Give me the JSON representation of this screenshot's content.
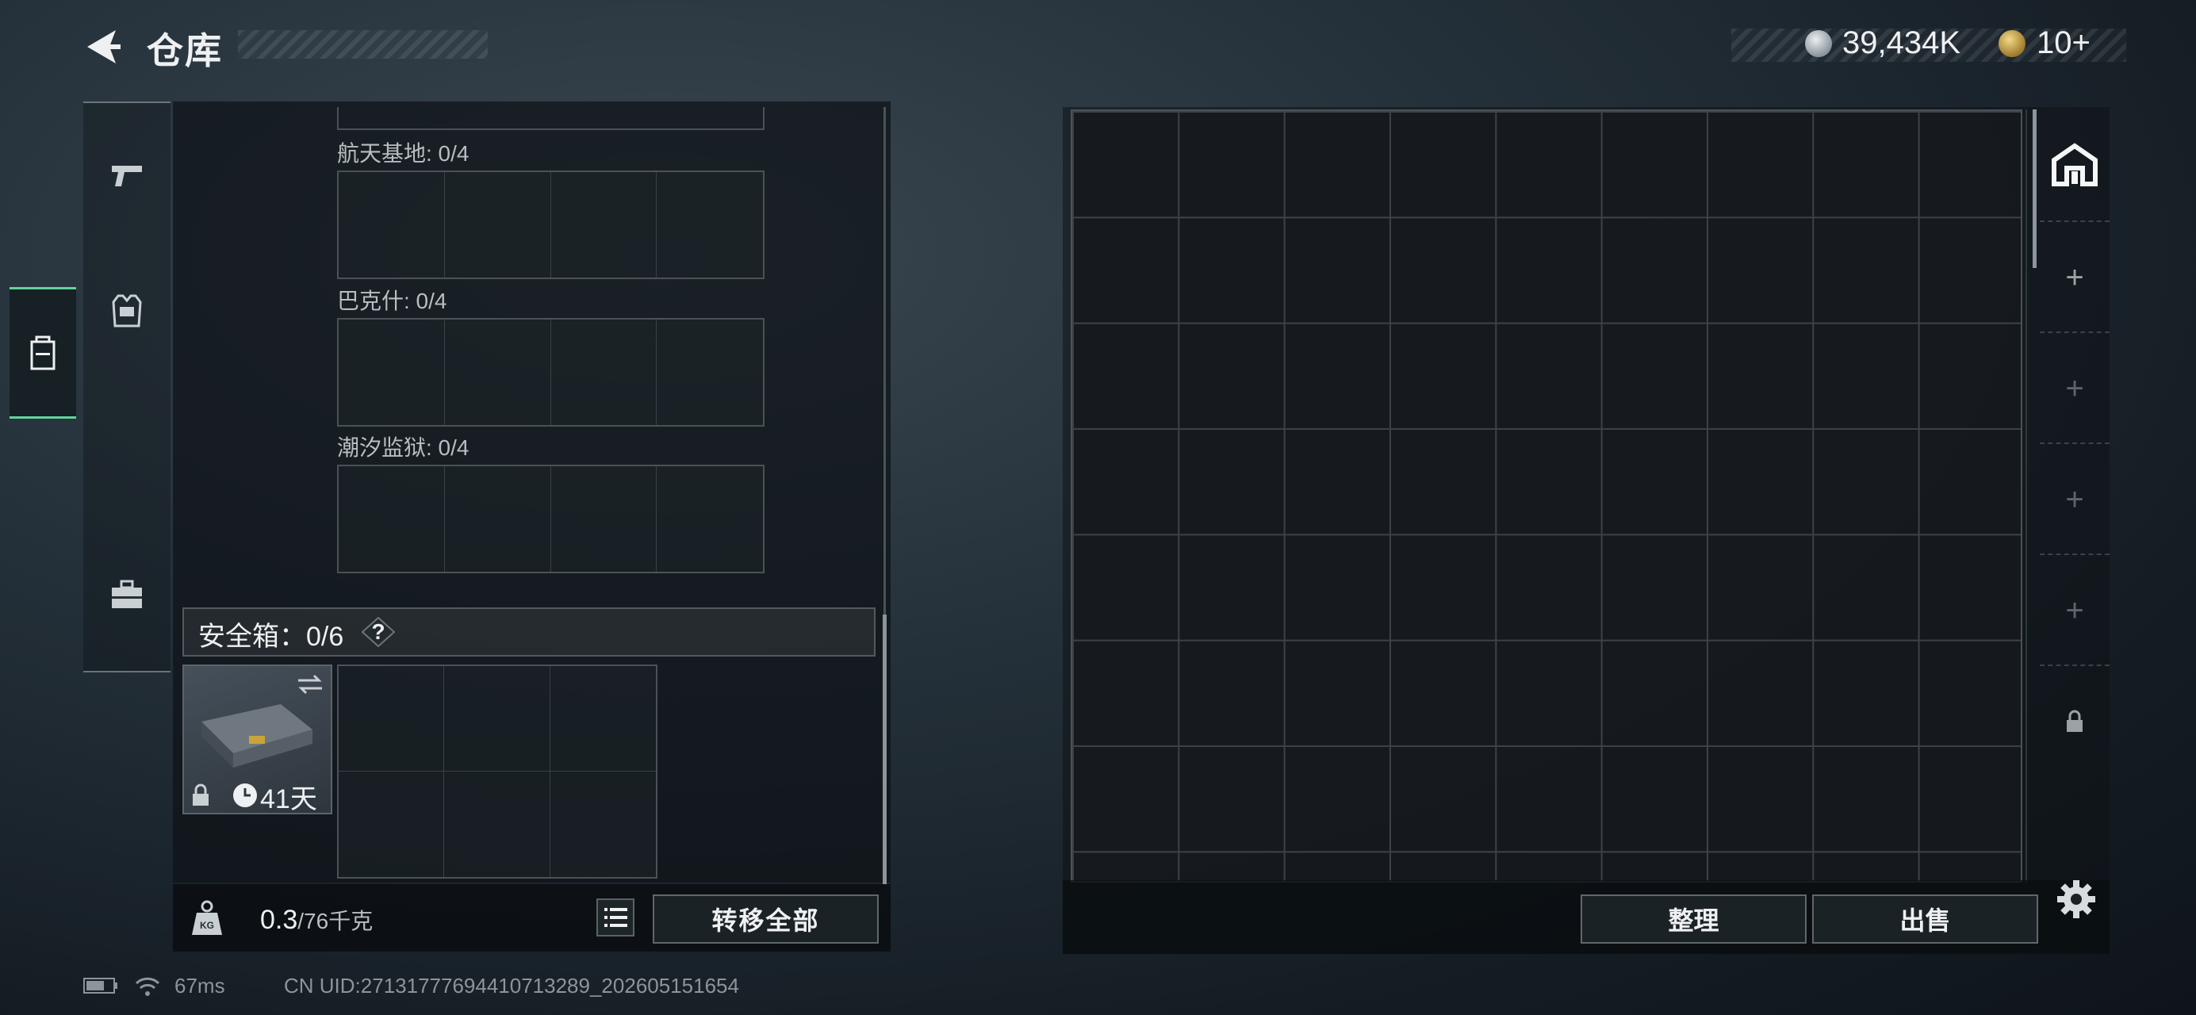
{
  "header": {
    "title": "仓库",
    "currency_silver": "39,434K",
    "currency_gold": "10+"
  },
  "sidebar": {
    "tabs": [
      {
        "icon": "pistol-icon",
        "active": false
      },
      {
        "icon": "armor-vest-icon",
        "active": false
      },
      {
        "icon": "backpack-icon",
        "active": true
      },
      {
        "icon": "toolbox-icon",
        "active": false
      }
    ]
  },
  "left_panel": {
    "slots": [
      {
        "label": "航天基地: 0/4"
      },
      {
        "label": "巴克什: 0/4"
      },
      {
        "label": "潮汐监狱: 0/4"
      }
    ],
    "safebox": {
      "label": "安全箱：0/6",
      "help": "?",
      "days": "41天"
    },
    "weight": {
      "current": "0.3",
      "total": "/76千克"
    },
    "transfer_all_label": "转移全部"
  },
  "right_panel": {
    "side_slots": [
      "+",
      "+",
      "+",
      "+"
    ],
    "sort_label": "整理",
    "sell_label": "出售"
  },
  "status_bar": {
    "ping": "67ms",
    "uid": "CN UID:27131777694410713289_202605151654"
  }
}
